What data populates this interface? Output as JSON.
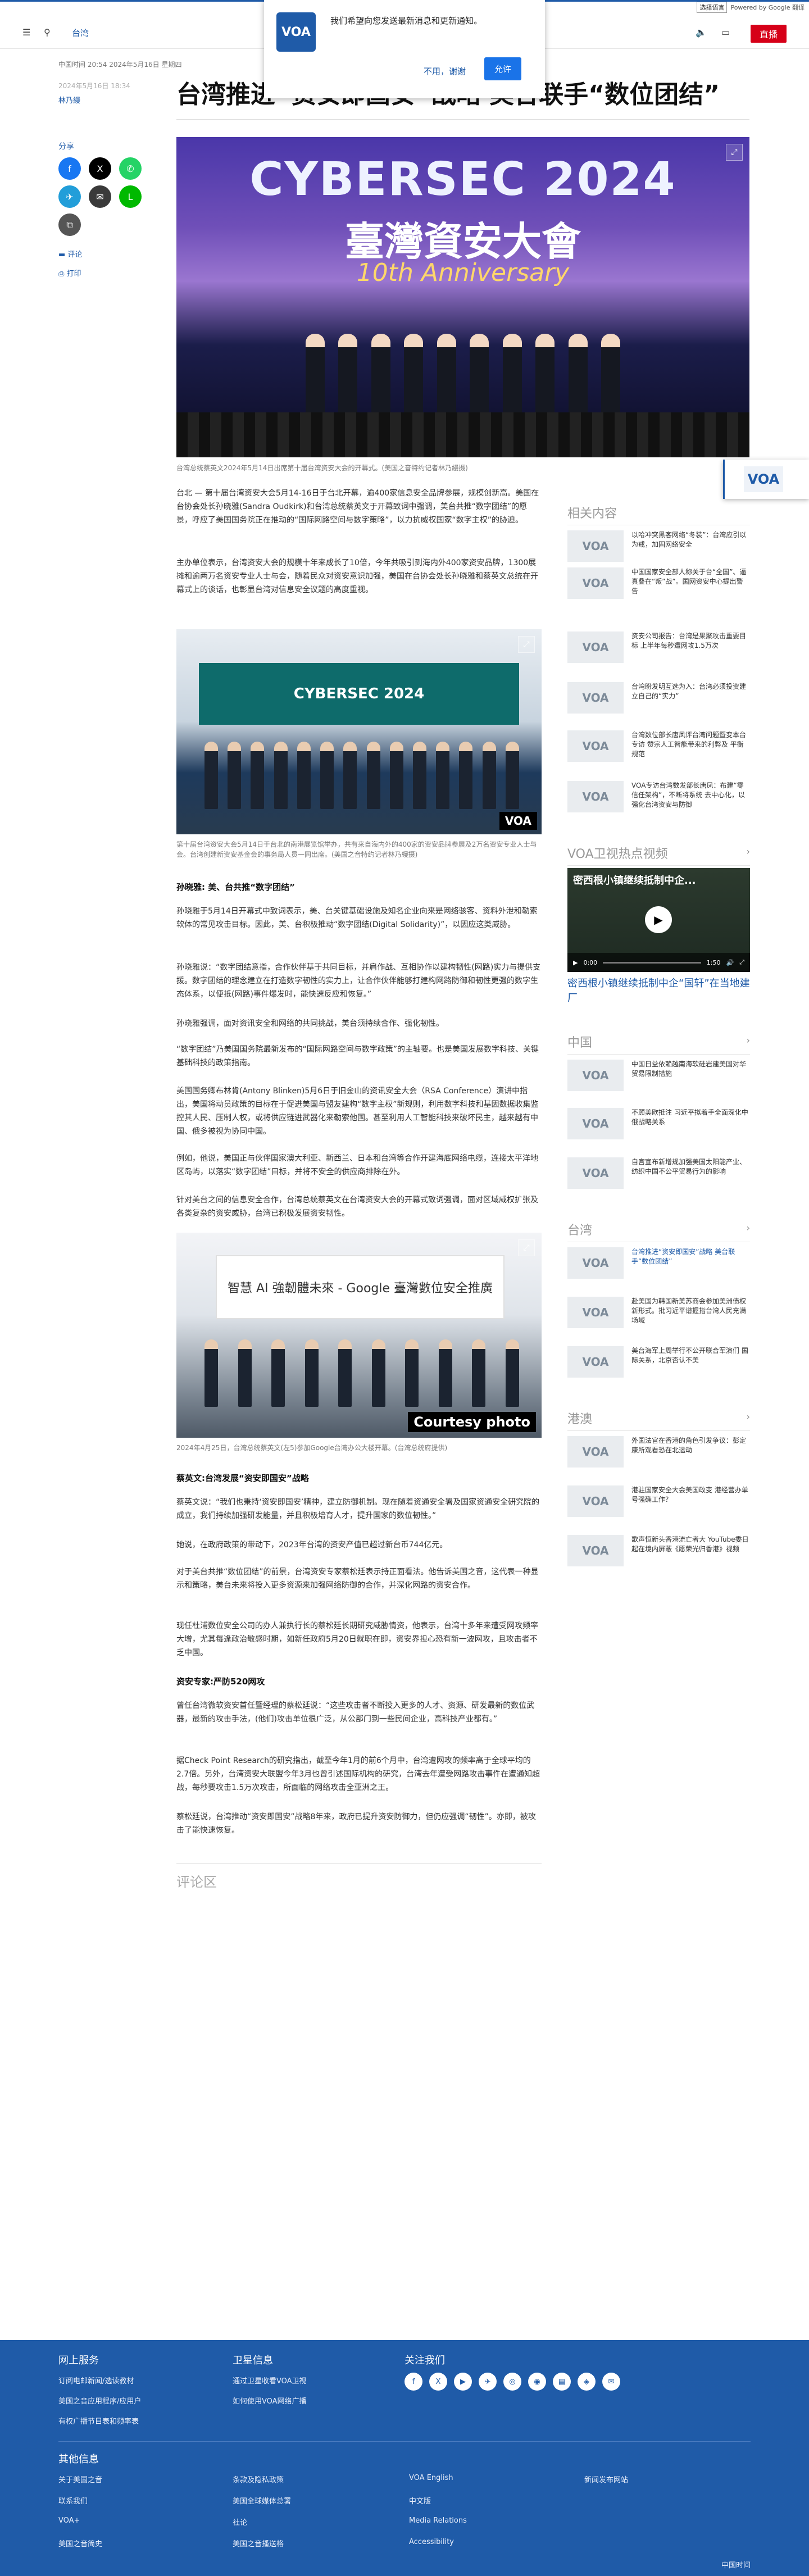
{
  "lang_bar": {
    "select": "选择语言",
    "powered": "Powered by Google 翻译"
  },
  "header": {
    "section": "台湾",
    "live": "直播"
  },
  "modal": {
    "text": "我们希望向您发送最新消息和更新通知。",
    "cancel": "不用，谢谢",
    "allow": "允许",
    "logo": "VOA"
  },
  "article": {
    "date_meta": "中国时间 20:54 2024年5月16日 星期四",
    "date_update": "2024年5月16日 18:34",
    "author": "林乃縵",
    "headline": "台湾推进“资安即国安”战略 美台联手“数位团结”",
    "hero": {
      "title": "CYBERSEC 2024",
      "sub": "臺灣資安大會",
      "anni": "10th Anniversary"
    },
    "caption1": "台湾总统蔡英文2024年5月14日出席第十届台湾资安大会的开幕式。(美国之音特约记者林乃縵摄)",
    "p1": "台北 — 第十届台湾资安大会5月14-16日于台北开幕，逾400家信息安全品牌参展，规模创新高。美国在台协会处长孙晓雅(Sandra Oudkirk)和台湾总统蔡英文于开幕致词中强调，美台共推“数字团结”的愿景，呼应了美国国务院正在推动的“国际网路空间与数字策略”，以力抗威权国家“数字主权”的胁迫。",
    "p2": "主办单位表示，台湾资安大会的规模十年来成长了10倍，今年共吸引到海内外400家资安品牌，1300展摊和逾两万名资安专业人士与会，随着民众对资安意识加强，美国在台协会处长孙晓雅和蔡英文总统在开幕式上的谈话，也彰显台湾对信息安全议题的高度重视。",
    "caption2": "第十届台湾资安大会5月14日于台北的南港展览馆举办，共有来自海内外的400家的资安品牌参展及2万名资安专业人士与会。台湾创建新资安基金会的事务局人员一同出席。(美国之音特约记者林乃縵摄)",
    "subhead1": "孙晓雅: 美、台共推“数字团结”",
    "p3": "孙晓雅于5月14日开幕式中致词表示，美、台关键基础设施及知名企业向来是网络骇客、资料外泄和勒索软体的常见攻击目标。因此，美、台积极推动“数字团结(Digital Solidarity)”，以因应这类威胁。",
    "p4": "孙晓雅说：“数字团结意指，合作伙伴基于共同目标，并肩作战、互相协作以建构韧性(网路)实力与提供支援。数字团结的理念建立在打造数字韧性的实力上，让合作伙伴能够打建构网路防御和韧性更强的数字生态体系，以便抵(网路)事件爆发时，能快速反应和恢复。”",
    "p5": "孙晓雅强调，面对资讯安全和网络的共同挑战，美台须持续合作、强化韧性。",
    "p6": "“数字团结”乃美国国务院最新发布的“国际网路空间与数字政策”的主轴要。也是美国发展数字科技、关键基础科技的政策指南。",
    "p7": "美国国务卿布林肯(Antony Blinken)5月6日于旧金山的资讯安全大会（RSA Conference）演讲中指出，美国将动员政策的目标在于促进美国与盟友建构“数字主权”新规则，利用数字科技和基因数据收集监控其人民、压制人权，或将供应链进武器化来勒索他国。甚至利用人工智能科技来破坏民主，越来越有中国、俄多被视为协同中国。",
    "p8": "例如，他说，美国正与伙伴国家澳大利亚、新西兰、日本和台湾等合作开建海底网络电缆，连接太平洋地区岛屿，以落实“数字团结”目标，并将不安全的供应商排除在外。",
    "p9": "针对美台之间的信息安全合作，台湾总统蔡英文在台湾资安大会的开幕式致词强调，面对区域威权扩张及各类复杂的资安威胁，台湾已积极发展资安韧性。",
    "photo3_banner": "智慧 AI 強韌體未來 - Google 臺灣數位安全推廣",
    "courtesy": "Courtesy photo",
    "caption3": "2024年4月25日，台湾总统蔡英文(左5)参加Google台湾办公大楼开幕。(台湾总统府提供)",
    "subhead2": "蔡英文:台湾发展“资安即国安”战略",
    "p10": "蔡英文说：“我们也秉持‘资安即国安’精神，建立防御机制。现在随着资通安全署及国家资通安全研究院的成立，我们持续加强研发能量，并且积极培育人才，提升国家的数位韧性。”",
    "p11": "她说，在政府政策的带动下，2023年台湾的资安产值已超过新台币744亿元。",
    "p12": "对于美台共推“数位团结”的前景，台湾资安专家蔡松廷表示持正面看法。他告诉美国之音，这代表一种显示和策略，美台未来将投入更多资源来加强网络防御的合作，并深化网路的资安合作。",
    "p13": "现任杜浦数位安全公司的办人兼执行长的蔡松廷长期研究威胁情资，他表示，台湾十多年来遭受网攻频率大增，尤其每逢政治敏感时期，如新任政府5月20日就职在即，资安界担心恐有新一波网攻，且攻击者不乏中国。",
    "subhead3": "资安专家:严防520网攻",
    "p14": "曾任台湾微软资安首任暨经理的蔡松廷说：“这些攻击者不断投入更多的人才、资源、研发最新的数位武器，最新的攻击手法，(他们)攻击单位很广泛，从公部门到一些民间企业，高科技产业都有。”",
    "p15": "据Check Point Research的研究指出，截至今年1月的前6个月中，台湾遭网攻的频率高于全球平均的2.7倍。另外，台湾资安大联盟今年3月也曾引述国际机构的研究，台湾去年遭受网路攻击事件在遭通知超战，每秒要攻击1.5万次攻击，所面临的网络攻击全亚洲之王。",
    "p16": "蔡松廷说，台湾推动“资安即国安”战略8年来，政府已提升资安防御力，但仍应强调“韧性”。亦即，被攻击了能快速恢复。",
    "comments": "评论区"
  },
  "share": {
    "label": "分享",
    "comments_link": "评论",
    "print_link": "打印"
  },
  "right": {
    "related_head": "相关内容",
    "related": [
      "以哈冲突黑客网络“冬装”：台湾应引以为戒，加固网络安全",
      "中国国家安全部人称关于台“全国”、逼真叠在“叛”战”。国网资安中心提出警告",
      "资安公司报告：台湾是果聚攻击重要目标 上半年每秒遭网攻1.5万次",
      "台湾盼发明互选为入：台湾必须投资建立自己的“实力”",
      "台湾数位部长唐凤评台湾问题暨变本台专访 赞宗人工智能带来的利弊及 平衡规范",
      "VOA专访台湾数发部长唐凤：布建“零信任架构”，不断将系统 去中心化，以强化台湾资安与防御"
    ],
    "video_head": "VOA卫视热点视频",
    "video_title": "密西根小镇继续抵制中企...",
    "video_time": "0:00",
    "video_dur": "1:50",
    "video_caption": "密西根小镇继续抵制中企“国轩”在当地建厂",
    "china_head": "中国",
    "china": [
      "中国日益依赖越南海软硅岩建美国对华贸易限制措施",
      "不顾美欧抵注 习近平拟着手全面深化中俄战略关系",
      "自宫宣布新增规加强美国太阳能产业、纺织中国不公平贸易行为的影响"
    ],
    "taiwan_head": "台湾",
    "taiwan": [
      "台湾推进“资安即国安”战略 美台联手“数位团结”",
      "赴美国为韩国新美苏商会参加美洲债权新形式。批习近平谱握指台湾人民充满场域",
      "美台海军上周举行不公开联合军演们 国际关系，北京否认不美"
    ],
    "hk_head": "港澳",
    "hk": [
      "外国法官在香港的角色引发争议：彭定康所观看恐在北运动",
      "港驻国家安全大会美国政变 港经营办单号强确工作？",
      "歌声恒新头香港流亡者大 YouTube委日起在境内屏蔽《愿荣光归香港》视频"
    ]
  },
  "footer": {
    "col1_head": "网上服务",
    "col1": [
      "订阅电邮新闻/选读教材",
      "美国之音应用程序/应用户",
      "有权广播节目表和频率表"
    ],
    "col2_head": "卫星信息",
    "col2": [
      "通过卫星收看VOA卫视",
      "如何使用VOA网络广播"
    ],
    "col3_head": "关注我们",
    "social": [
      "f",
      "X",
      "▶",
      "✈",
      "◎",
      "◉",
      "▤",
      "◈",
      "✉"
    ],
    "other_head": "其他信息",
    "other": [
      [
        "关于美国之音",
        "条款及隐私政策",
        "VOA English",
        "新闻发布网站"
      ],
      [
        "联系我们",
        "美国全球媒体总署",
        "中文版",
        ""
      ],
      [
        "VOA+",
        "社论",
        "Media Relations",
        ""
      ],
      [
        "美国之音简史",
        "美国之音播送格",
        "Accessibility",
        ""
      ]
    ],
    "time_label": "中国时间"
  },
  "colors": {
    "brand": "#1f5ba8",
    "live": "#d60018",
    "facebook": "#1877f2",
    "x": "#000000",
    "whatsapp": "#25d366",
    "telegram": "#229ed9",
    "email": "#3a3a3a",
    "line": "#00b900",
    "copy": "#555555"
  }
}
